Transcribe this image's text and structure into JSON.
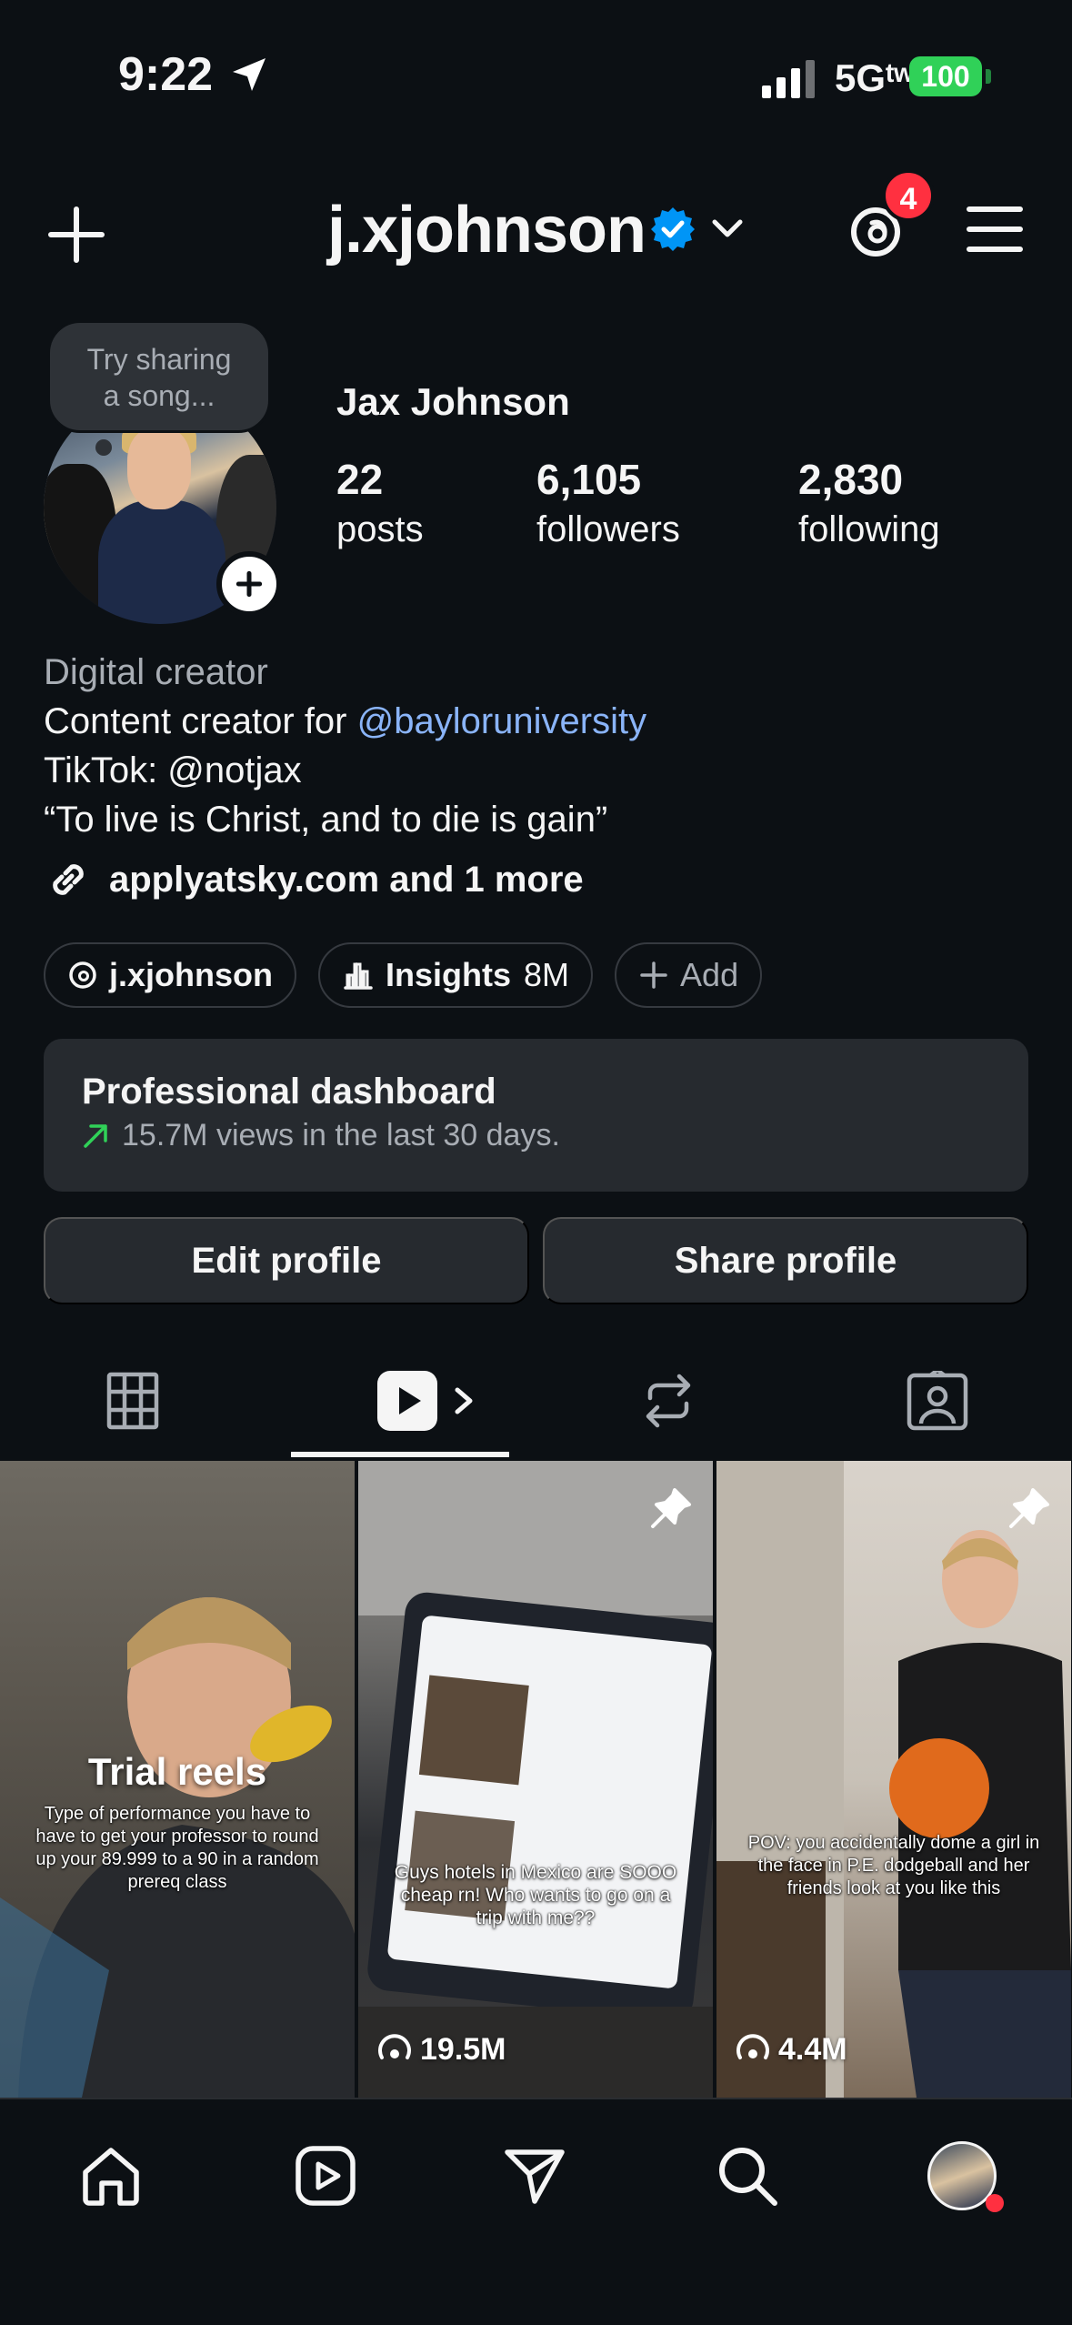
{
  "status_bar": {
    "time": "9:22",
    "network": "5Gᵗʷ",
    "battery": "100"
  },
  "header": {
    "username": "j.xjohnson",
    "notification_count": "4"
  },
  "profile": {
    "note_placeholder": "Try sharing a song...",
    "note_line1": "Try sharing",
    "note_line2": "a song...",
    "display_name": "Jax Johnson",
    "stats": [
      {
        "value": "22",
        "label": "posts"
      },
      {
        "value": "6,105",
        "label": "followers"
      },
      {
        "value": "2,830",
        "label": "following"
      }
    ],
    "category": "Digital creator",
    "bio_prefix": "Content creator for ",
    "bio_mention": "@bayloruniversity",
    "bio_line2": "TikTok: @notjax",
    "bio_line3": "“To live is Christ, and to die is gain”",
    "link_text": "applyatsky.com and 1 more"
  },
  "chips": {
    "threads_label": "j.xjohnson",
    "insights_label": "Insights",
    "insights_value": "8M",
    "add_label": "Add"
  },
  "dashboard": {
    "title": "Professional dashboard",
    "subtitle": "15.7M views in the last 30 days."
  },
  "buttons": {
    "edit": "Edit profile",
    "share": "Share profile"
  },
  "grid": [
    {
      "title": "Trial reels",
      "caption": "Type of performance you have to have to get your professor to round up your 89.999 to a 90 in a random prereq class"
    },
    {
      "caption": "Guys hotels in Mexico are SOOO cheap rn! Who wants to go on a trip with me??",
      "views": "19.5M",
      "pinned": true
    },
    {
      "caption": "POV: you accidentally dome a girl in the face in P.E. dodgeball and her friends look at you like this",
      "views": "4.4M",
      "pinned": true
    }
  ],
  "colors": {
    "background": "#0c1014",
    "accent": "#0095f6",
    "mention": "#8ab4f8",
    "badge": "#ff3040",
    "battery": "#30d158"
  }
}
